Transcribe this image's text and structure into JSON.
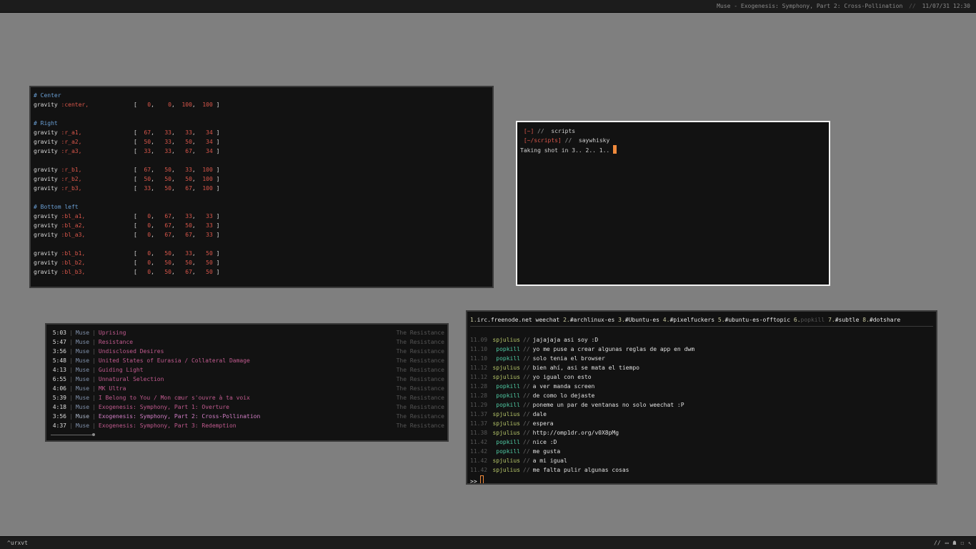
{
  "topbar": {
    "now_playing": "Muse - Exogenesis: Symphony, Part 2: Cross-Pollination",
    "separator": "//",
    "datetime": "11/07/31 12:30"
  },
  "bottombar": {
    "tag": "^urxvt",
    "tray_sep": "//",
    "tray_icons": [
      "terminal-icon",
      "ghost-icon",
      "robot-icon",
      "cursor-icon"
    ]
  },
  "config": {
    "keyword": "gravity",
    "groups": [
      {
        "comment": "# Center",
        "rows": [
          {
            "sym": ":center,",
            "vals": [
              "0",
              "0",
              "100",
              "100"
            ]
          }
        ]
      },
      {
        "comment": "# Right",
        "rows": [
          {
            "sym": ":r_a1,",
            "vals": [
              "67",
              "33",
              "33",
              "34"
            ]
          },
          {
            "sym": ":r_a2,",
            "vals": [
              "50",
              "33",
              "50",
              "34"
            ]
          },
          {
            "sym": ":r_a3,",
            "vals": [
              "33",
              "33",
              "67",
              "34"
            ]
          }
        ]
      },
      {
        "comment": "",
        "rows": [
          {
            "sym": ":r_b1,",
            "vals": [
              "67",
              "50",
              "33",
              "100"
            ]
          },
          {
            "sym": ":r_b2,",
            "vals": [
              "50",
              "50",
              "50",
              "100"
            ]
          },
          {
            "sym": ":r_b3,",
            "vals": [
              "33",
              "50",
              "67",
              "100"
            ]
          }
        ]
      },
      {
        "comment": "# Bottom left",
        "rows": [
          {
            "sym": ":bl_a1,",
            "vals": [
              "0",
              "67",
              "33",
              "33"
            ]
          },
          {
            "sym": ":bl_a2,",
            "vals": [
              "0",
              "67",
              "50",
              "33"
            ]
          },
          {
            "sym": ":bl_a3,",
            "vals": [
              "0",
              "67",
              "67",
              "33"
            ]
          }
        ]
      },
      {
        "comment": "",
        "rows": [
          {
            "sym": ":bl_b1,",
            "vals": [
              "0",
              "50",
              "33",
              "50"
            ]
          },
          {
            "sym": ":bl_b2,",
            "vals": [
              "0",
              "50",
              "50",
              "50"
            ]
          },
          {
            "sym": ":bl_b3,",
            "vals": [
              "0",
              "50",
              "67",
              "50"
            ]
          }
        ]
      }
    ]
  },
  "terminal": {
    "prompt1_path": "[~]",
    "prompt1_sep": "//",
    "prompt1_cmd": "scripts",
    "prompt2_path": "[~/scripts]",
    "prompt2_sep": "//",
    "prompt2_cmd": "saywhisky",
    "output": "Taking shot in 3.. 2.. 1.."
  },
  "music": {
    "progress": 0.12,
    "tracks": [
      {
        "time": "5:03",
        "artist": "Muse",
        "title": "Uprising",
        "album": "The Resistance"
      },
      {
        "time": "5:47",
        "artist": "Muse",
        "title": "Resistance",
        "album": "The Resistance"
      },
      {
        "time": "3:56",
        "artist": "Muse",
        "title": "Undisclosed Desires",
        "album": "The Resistance"
      },
      {
        "time": "5:48",
        "artist": "Muse",
        "title": "United States of Eurasia / Collateral Damage",
        "album": "The Resistance"
      },
      {
        "time": "4:13",
        "artist": "Muse",
        "title": "Guiding Light",
        "album": "The Resistance"
      },
      {
        "time": "6:55",
        "artist": "Muse",
        "title": "Unnatural Selection",
        "album": "The Resistance"
      },
      {
        "time": "4:06",
        "artist": "Muse",
        "title": "MK Ultra",
        "album": "The Resistance"
      },
      {
        "time": "5:39",
        "artist": "Muse",
        "title": "I Belong to You / Mon cœur s'ouvre à ta voix",
        "album": "The Resistance"
      },
      {
        "time": "4:18",
        "artist": "Muse",
        "title": "Exogenesis: Symphony, Part 1: Overture",
        "album": "The Resistance"
      },
      {
        "time": "3:56",
        "artist": "Muse",
        "title": "Exogenesis: Symphony, Part 2: Cross-Pollination",
        "album": "The Resistance",
        "current": true
      },
      {
        "time": "4:37",
        "artist": "Muse",
        "title": "Exogenesis: Symphony, Part 3: Redemption",
        "album": "The Resistance"
      }
    ]
  },
  "irc": {
    "channels": [
      {
        "num": "1.",
        "name": "irc.freenode.net weechat",
        "dim": false
      },
      {
        "num": "2.",
        "name": "#archlinux-es",
        "dim": false
      },
      {
        "num": "3.",
        "name": "#Ubuntu-es",
        "dim": false
      },
      {
        "num": "4.",
        "name": "#pixelfuckers",
        "dim": false
      },
      {
        "num": "5.",
        "name": "#ubuntu-es-offtopic",
        "dim": false
      },
      {
        "num": "6.",
        "name": "popkill",
        "dim": true
      },
      {
        "num": "7.",
        "name": "#subtle",
        "dim": false
      },
      {
        "num": "8.",
        "name": "#dotshare",
        "dim": false
      }
    ],
    "separator": "//",
    "messages": [
      {
        "time": "11.09",
        "nick": "spjulius",
        "msg": "jajajaja asi soy :D"
      },
      {
        "time": "11.10",
        "nick": "popkill",
        "msg": "yo me puse a crear algunas reglas de app en dwm"
      },
      {
        "time": "11.10",
        "nick": "popkill",
        "msg": "solo tenia el browser"
      },
      {
        "time": "11.12",
        "nick": "spjulius",
        "msg": "bien ahí, asi se mata el tiempo"
      },
      {
        "time": "11.12",
        "nick": "spjulius",
        "msg": "yo igual con esto"
      },
      {
        "time": "11.28",
        "nick": "popkill",
        "msg": "a ver manda screen"
      },
      {
        "time": "11.28",
        "nick": "popkill",
        "msg": "de como lo dejaste"
      },
      {
        "time": "11.29",
        "nick": "popkill",
        "msg": "poneme un par de ventanas no solo weechat :P"
      },
      {
        "time": "11.37",
        "nick": "spjulius",
        "msg": "dale"
      },
      {
        "time": "11.37",
        "nick": "spjulius",
        "msg": "espera"
      },
      {
        "time": "11.38",
        "nick": "spjulius",
        "msg": "http://omp1dr.org/v0X8pMg"
      },
      {
        "time": "11.42",
        "nick": "popkill",
        "msg": "nice :D"
      },
      {
        "time": "11.42",
        "nick": "popkill",
        "msg": "me gusta"
      },
      {
        "time": "11.42",
        "nick": "spjulius",
        "msg": "a mi igual"
      },
      {
        "time": "11.42",
        "nick": "spjulius",
        "msg": "me falta pulir algunas cosas"
      }
    ],
    "input_prompt": ">>"
  }
}
